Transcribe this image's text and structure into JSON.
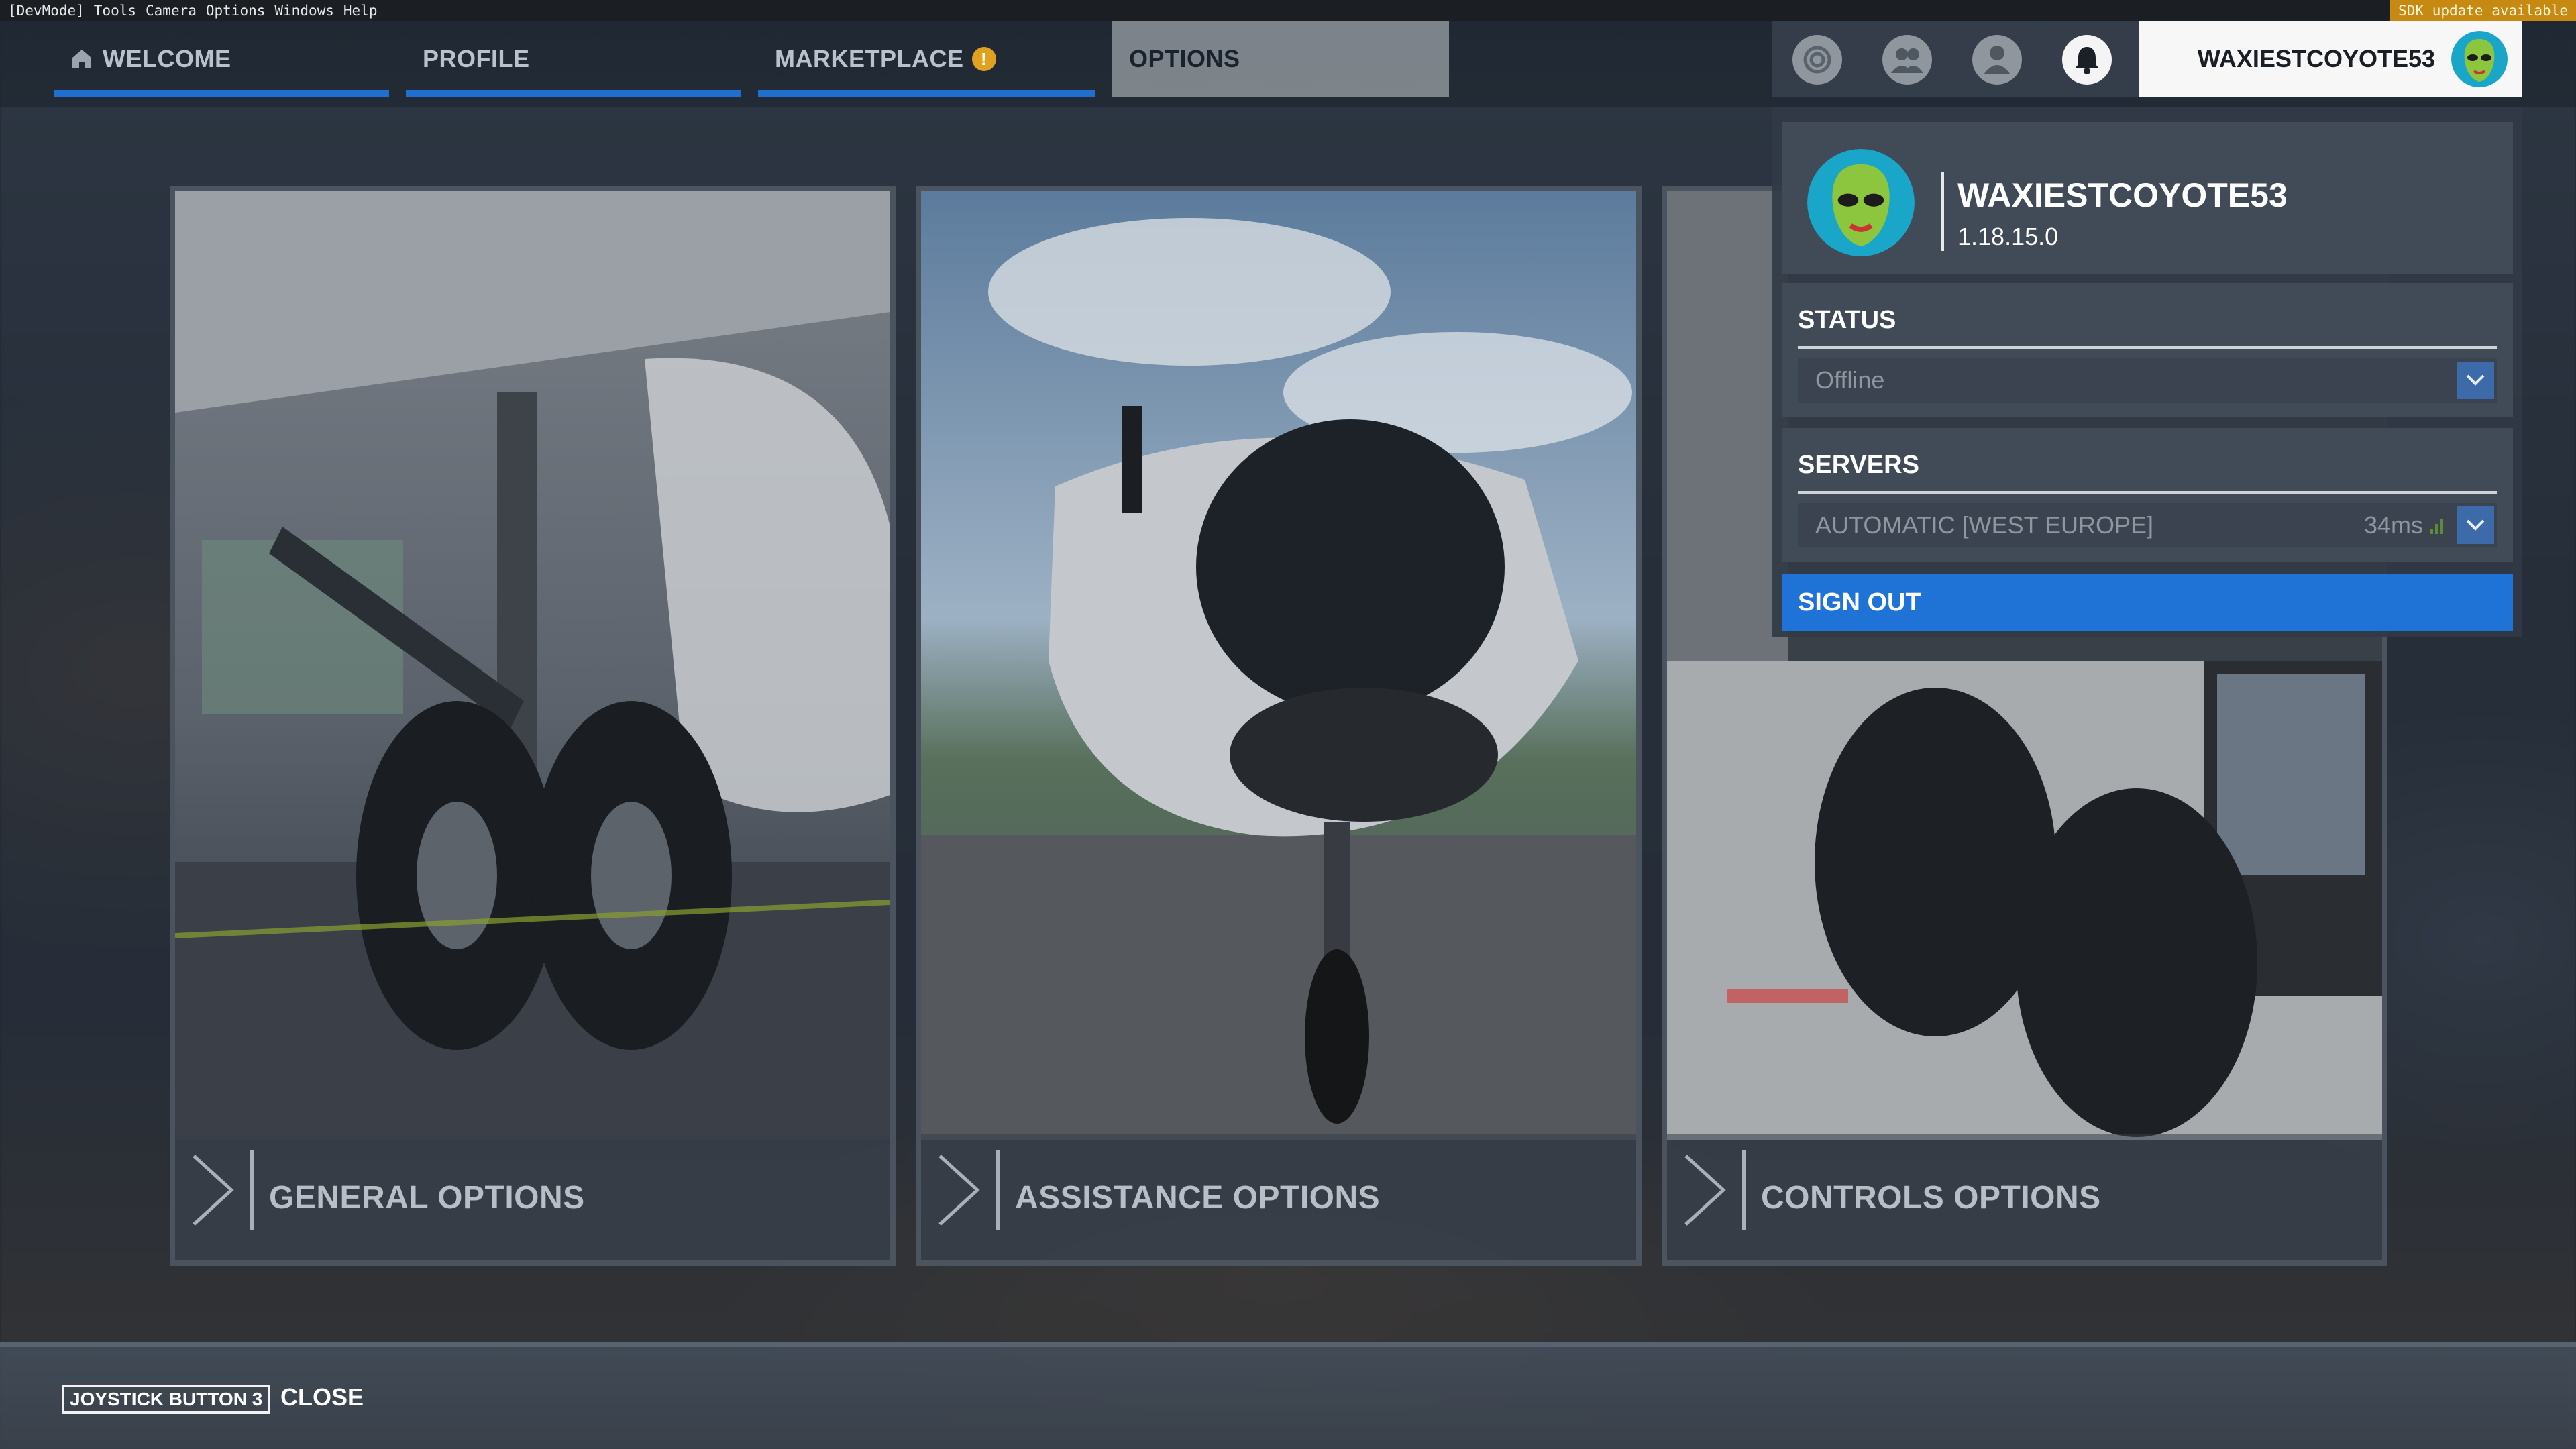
{
  "devbar": {
    "items": [
      "[DevMode]",
      "Tools",
      "Camera",
      "Options",
      "Windows",
      "Help"
    ],
    "sdk_notice": "SDK update available"
  },
  "nav": {
    "tabs": [
      {
        "label": "WELCOME",
        "icon": "home-icon"
      },
      {
        "label": "PROFILE"
      },
      {
        "label": "MARKETPLACE",
        "badge": "!"
      },
      {
        "label": "OPTIONS",
        "active": true
      }
    ],
    "accent": "#1f6fcf"
  },
  "account": {
    "username": "WAXIESTCOYOTE53",
    "version": "1.18.15.0"
  },
  "dropdown": {
    "status_title": "STATUS",
    "status_value": "Offline",
    "servers_title": "SERVERS",
    "server_value": "AUTOMATIC [WEST EUROPE]",
    "server_ping": "34ms",
    "sign_out": "SIGN OUT",
    "sign_out_color": "#1f72d6"
  },
  "cards": [
    {
      "label": "GENERAL OPTIONS"
    },
    {
      "label": "ASSISTANCE OPTIONS"
    },
    {
      "label": "CONTROLS OPTIONS"
    }
  ],
  "bottom": {
    "key": "JOYSTICK BUTTON 3",
    "action": "CLOSE"
  }
}
